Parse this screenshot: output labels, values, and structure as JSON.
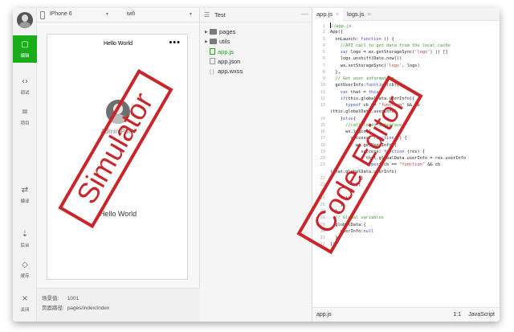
{
  "sidebar": {
    "items": [
      {
        "icon": "code-icon",
        "label": "编辑"
      },
      {
        "icon": "debug-icon",
        "label": "调试"
      },
      {
        "icon": "project-icon",
        "label": "项目"
      },
      {
        "icon": "compile-icon",
        "label": "编译"
      },
      {
        "icon": "background-icon",
        "label": "后台"
      },
      {
        "icon": "cache-icon",
        "label": "缓存"
      },
      {
        "icon": "close-icon",
        "label": "关闭"
      }
    ]
  },
  "simulator": {
    "device": "iPhone 6",
    "network": "wifi",
    "nav_title": "Hello World",
    "nav_dots": "•••",
    "user_name": "Admin Patel",
    "motto": "Hello World",
    "footer": {
      "scene_label": "场景值:",
      "scene_value": "1001",
      "path_label": "页面路径:",
      "path_value": "pages/index/index"
    }
  },
  "tree": {
    "title": "Test",
    "nodes": [
      {
        "name": "pages"
      },
      {
        "name": "utils"
      },
      {
        "name": "app.js"
      },
      {
        "name": "app.json"
      },
      {
        "name": "app.wxss"
      }
    ]
  },
  "editor": {
    "tabs": [
      {
        "label": "app.js",
        "close": "×"
      },
      {
        "label": "logs.js",
        "close": "×"
      }
    ],
    "status": {
      "file": "app.js",
      "position": "1:1",
      "language": "JavaScript"
    }
  },
  "overlays": {
    "simulator_label": "Simulator",
    "editor_label": "Code Editor"
  }
}
